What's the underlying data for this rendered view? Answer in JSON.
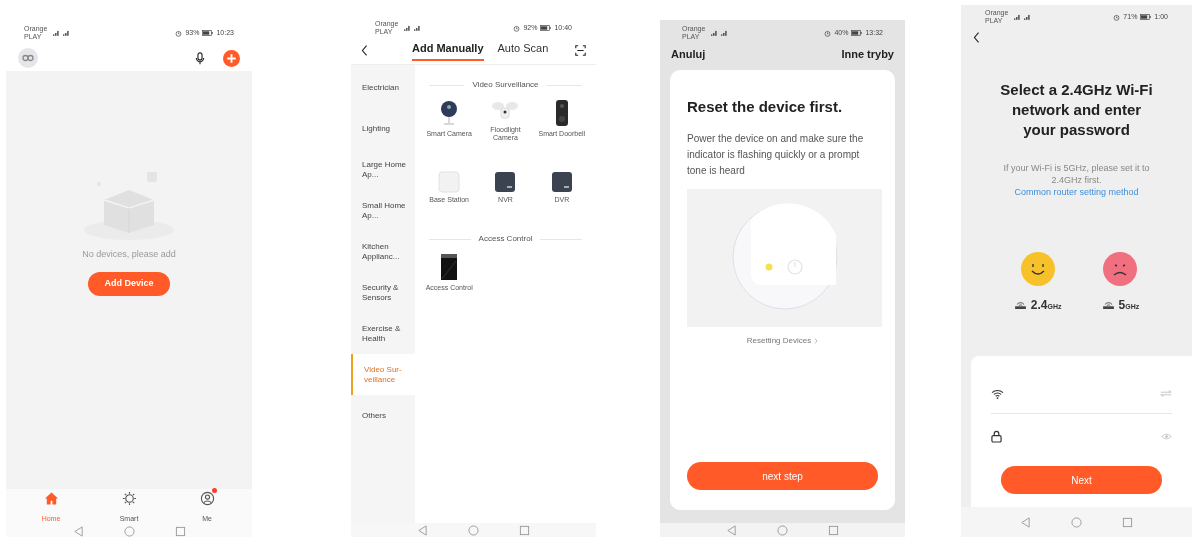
{
  "phones": [
    {
      "kind": "home",
      "status": {
        "carrier": "Orange PLAY",
        "battery": "93%",
        "time": "10:23"
      },
      "empty_message": "No devices, please add",
      "add_button": "Add Device",
      "nav": [
        {
          "label": "Home",
          "selected": true,
          "badge": false
        },
        {
          "label": "Smart",
          "selected": false,
          "badge": false
        },
        {
          "label": "Me",
          "selected": false,
          "badge": true
        }
      ]
    },
    {
      "kind": "add_manually",
      "status": {
        "carrier": "Orange PLAY",
        "battery": "92%",
        "time": "10:40"
      },
      "tabs": [
        {
          "label": "Add Manually",
          "selected": true
        },
        {
          "label": "Auto Scan",
          "selected": false
        }
      ],
      "categories": [
        {
          "label": "Electrician",
          "selected": false
        },
        {
          "label": "Lighting",
          "selected": false
        },
        {
          "label": "Large Home Ap...",
          "selected": false
        },
        {
          "label": "Small Home Ap...",
          "selected": false
        },
        {
          "label": "Kitchen Applianc...",
          "selected": false
        },
        {
          "label": "Security & Sensors",
          "selected": false
        },
        {
          "label": "Exercise & Health",
          "selected": false
        },
        {
          "label": "Video Sur-veillance",
          "selected": true
        },
        {
          "label": "Others",
          "selected": false
        }
      ],
      "sections": [
        {
          "title": "Video Surveillance",
          "devices": [
            {
              "label": "Smart Camera",
              "kind": "camera"
            },
            {
              "label": "Floodlight Camera",
              "kind": "floodlight"
            },
            {
              "label": "Smart Doorbell",
              "kind": "doorbell"
            },
            {
              "label": "Base Station",
              "kind": "base"
            },
            {
              "label": "NVR",
              "kind": "recorder"
            },
            {
              "label": "DVR",
              "kind": "recorder"
            }
          ]
        },
        {
          "title": "Access Control",
          "devices": [
            {
              "label": "Access Control",
              "kind": "panel"
            }
          ]
        }
      ]
    },
    {
      "kind": "reset",
      "status": {
        "carrier": "Orange PLAY",
        "battery": "40%",
        "time": "13:32"
      },
      "cancel": "Anuluj",
      "other_modes": "Inne tryby",
      "title": "Reset the device first.",
      "description": "Power the device on and make sure the indicator is flashing quickly or a prompt tone is heard",
      "help_link": "Resetting Devices",
      "button": "next step"
    },
    {
      "kind": "wifi",
      "status": {
        "carrier": "Orange PLAY",
        "battery": "71%",
        "time": "1:00"
      },
      "title": "Select a 2.4GHz Wi-Fi network and enter your password",
      "note": "If your Wi-Fi is 5GHz, please set it to 2.4GHz first.",
      "note_link": "Common router setting method",
      "bands": [
        {
          "value": "2.4",
          "unit": "GHz",
          "supported": true
        },
        {
          "value": "5",
          "unit": "GHz",
          "supported": false
        }
      ],
      "button": "Next"
    }
  ]
}
